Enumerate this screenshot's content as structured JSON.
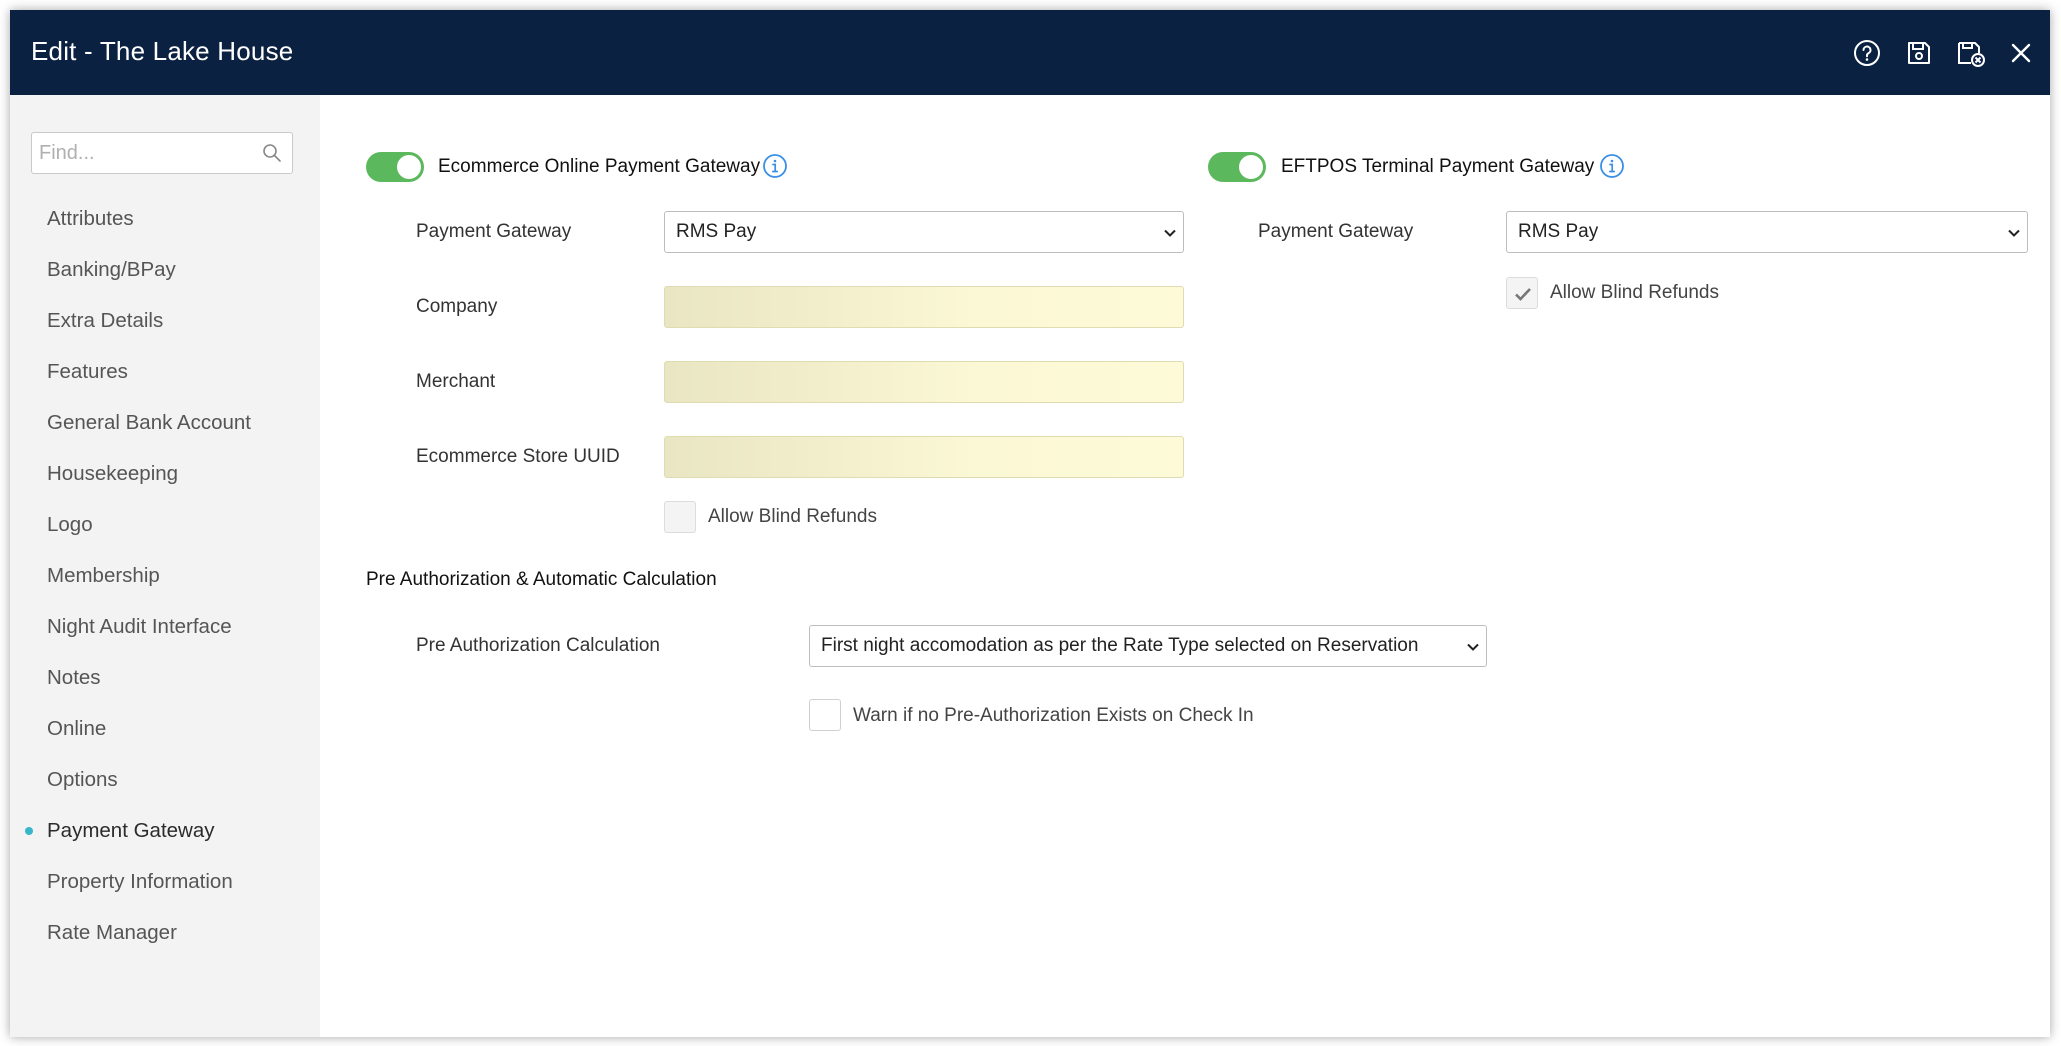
{
  "window": {
    "title": "Edit - The Lake House",
    "icons": [
      "help-icon",
      "save-icon",
      "save-close-icon",
      "close-icon"
    ]
  },
  "sidebar": {
    "search_placeholder": "Find...",
    "items": [
      {
        "label": "Attributes"
      },
      {
        "label": "Banking/BPay"
      },
      {
        "label": "Extra Details"
      },
      {
        "label": "Features"
      },
      {
        "label": "General Bank Account"
      },
      {
        "label": "Housekeeping"
      },
      {
        "label": "Logo"
      },
      {
        "label": "Membership"
      },
      {
        "label": "Night Audit Interface"
      },
      {
        "label": "Notes"
      },
      {
        "label": "Online"
      },
      {
        "label": "Options"
      },
      {
        "label": "Payment Gateway"
      },
      {
        "label": "Property Information"
      },
      {
        "label": "Rate Manager"
      }
    ],
    "active_item": "Payment Gateway",
    "active_dot_color": "#37b6c9"
  },
  "ecommerce": {
    "title": "Ecommerce Online Payment Gateway",
    "enabled": true,
    "payment_gateway_label": "Payment Gateway",
    "payment_gateway_value": "RMS Pay",
    "company_label": "Company",
    "merchant_label": "Merchant",
    "store_uuid_label": "Ecommerce Store UUID",
    "allow_blind_refunds_label": "Allow Blind Refunds",
    "allow_blind_refunds_checked": false
  },
  "eftpos": {
    "title": "EFTPOS Terminal Payment Gateway",
    "enabled": true,
    "payment_gateway_label": "Payment Gateway",
    "payment_gateway_value": "RMS Pay",
    "allow_blind_refunds_label": "Allow Blind Refunds",
    "allow_blind_refunds_checked": true
  },
  "preauth": {
    "title": "Pre Authorization & Automatic Calculation",
    "calculation_label": "Pre Authorization Calculation",
    "calculation_value": "First night accomodation as per the Rate Type selected on Reservation",
    "warn_label": "Warn if no Pre-Authorization Exists on Check In",
    "warn_checked": false
  },
  "colors": {
    "titlebar": "#0b2141",
    "toggle_on": "#5cb85c",
    "info_icon": "#3a8ee6",
    "masked_field": "#fbf8d5"
  }
}
